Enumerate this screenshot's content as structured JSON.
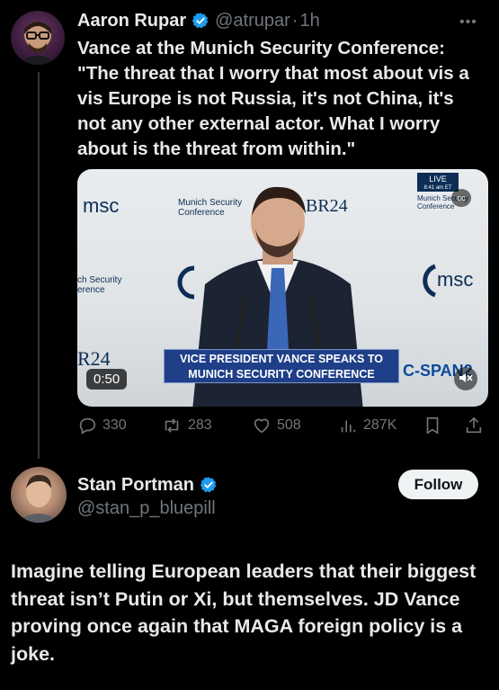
{
  "tweet": {
    "author_name": "Aaron Rupar",
    "author_handle": "@atrupar",
    "separator": "·",
    "time": "1h",
    "text": "Vance at the Munich Security Conference: \"The threat that I worry that most about vis a vis Europe is not Russia, it's not China, it's not any other external actor. What I worry about is the threat from within.\"",
    "media": {
      "duration": "0:50",
      "chyron_line1": "VICE PRESIDENT VANCE SPEAKS TO",
      "chyron_line2": "MUNICH SECURITY CONFERENCE",
      "live_badge": "LIVE",
      "live_time": "8:41 am ET",
      "network": "C-SPAN2",
      "bg_text_msc": "msc",
      "bg_text_munich": "Munich Security",
      "bg_text_conference": "Conference",
      "bg_text_br24": "BR24",
      "bg_text_ch_security": "ch Security",
      "bg_text_erence": "erence",
      "bg_text_r24": "R24",
      "cc_label": "cc"
    },
    "stats": {
      "replies": "330",
      "reposts": "283",
      "likes": "508",
      "views": "287K"
    }
  },
  "reply": {
    "author_name": "Stan Portman",
    "author_handle": "@stan_p_bluepill",
    "follow_label": "Follow",
    "text": "Imagine telling European leaders that their biggest threat isn’t Putin or Xi, but themselves. JD Vance proving once again that MAGA foreign policy is a joke."
  },
  "colors": {
    "background": "#000000",
    "text_primary": "#e7e9ea",
    "text_secondary": "#71767b",
    "verified": "#1d9bf0",
    "chyron": "#1f3f88"
  }
}
